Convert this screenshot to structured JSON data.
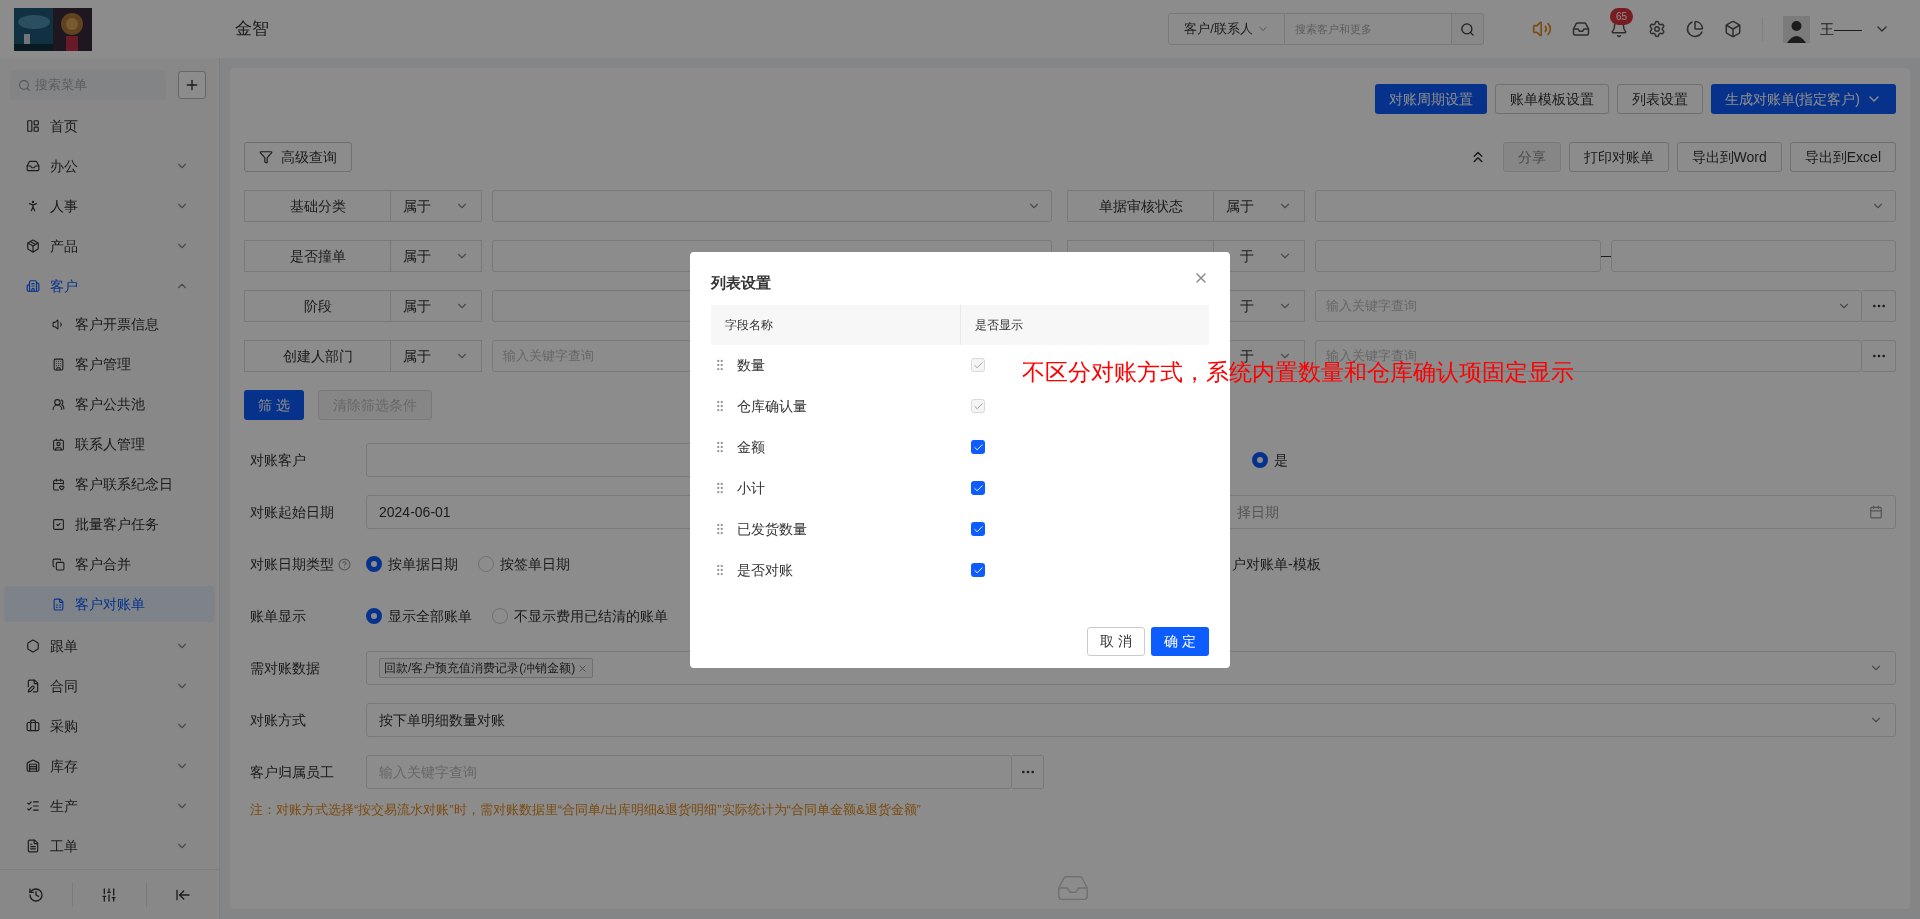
{
  "header": {
    "title": "金智",
    "search_scope": "客户/联系人",
    "search_placeholder": "搜索客户和更多",
    "notification_count": "65",
    "user_name": "王——"
  },
  "sidebar": {
    "search_placeholder": "搜索菜单",
    "items": [
      {
        "label": "首页"
      },
      {
        "label": "办公",
        "expanded": false
      },
      {
        "label": "人事",
        "expanded": false
      },
      {
        "label": "产品",
        "expanded": false
      },
      {
        "label": "客户",
        "expanded": true,
        "children": [
          {
            "label": "客户开票信息",
            "selected": false
          },
          {
            "label": "客户管理",
            "selected": false
          },
          {
            "label": "客户公共池",
            "selected": false
          },
          {
            "label": "联系人管理",
            "selected": false
          },
          {
            "label": "客户联系纪念日",
            "selected": false
          },
          {
            "label": "批量客户任务",
            "selected": false
          },
          {
            "label": "客户合并",
            "selected": false
          },
          {
            "label": "客户对账单",
            "selected": true
          }
        ]
      },
      {
        "label": "跟单",
        "expanded": false
      },
      {
        "label": "合同",
        "expanded": false
      },
      {
        "label": "采购",
        "expanded": false
      },
      {
        "label": "库存",
        "expanded": false
      },
      {
        "label": "生产",
        "expanded": false
      },
      {
        "label": "工单",
        "expanded": false
      }
    ]
  },
  "toolbar": [
    {
      "label": "对账周期设置",
      "kind": "primary"
    },
    {
      "label": "账单模板设置",
      "kind": "default"
    },
    {
      "label": "列表设置",
      "kind": "default"
    },
    {
      "label": "生成对账单(指定客户)",
      "kind": "menu"
    }
  ],
  "advanced_query": "高级查询",
  "actions": [
    {
      "label": "分享",
      "disabled": true
    },
    {
      "label": "打印对账单",
      "disabled": false
    },
    {
      "label": "导出到Word",
      "disabled": false
    },
    {
      "label": "导出到Excel",
      "disabled": false
    }
  ],
  "filters_left": [
    {
      "label": "基础分类",
      "operator": "属于",
      "kind": "select"
    },
    {
      "label": "是否撞单",
      "operator": "属于",
      "kind": "select"
    },
    {
      "label": "阶段",
      "operator": "属于",
      "kind": "select"
    },
    {
      "label": "创建人部门",
      "operator": "属于",
      "kind": "text",
      "placeholder": "输入关键字查询"
    }
  ],
  "filters_right": [
    {
      "label": "单据审核状态",
      "operator": "属于",
      "kind": "select"
    },
    {
      "operator": "于",
      "kind": "range"
    },
    {
      "operator": "于",
      "kind": "select_lookup",
      "placeholder": "输入关键字查询"
    },
    {
      "operator": "于",
      "kind": "text_lookup",
      "placeholder": "输入关键字查询"
    }
  ],
  "filter_buttons": [
    {
      "label": "筛 选",
      "disabled": false
    },
    {
      "label": "清除筛选条件",
      "disabled": true
    }
  ],
  "form": [
    {
      "label": "对账客户",
      "kind": "input",
      "aside": {
        "kind": "radio",
        "options": [
          {
            "label": "是",
            "selected": true
          }
        ]
      }
    },
    {
      "label": "对账起始日期",
      "kind": "input",
      "value": "2024-06-01",
      "aside": {
        "kind": "date",
        "placeholder": "择日期"
      }
    },
    {
      "label": "对账日期类型",
      "help": true,
      "kind": "radio",
      "options": [
        {
          "label": "按单据日期",
          "selected": true
        },
        {
          "label": "按签单日期",
          "selected": false
        }
      ],
      "aside": {
        "kind": "text",
        "text": "户对账单-模板"
      }
    },
    {
      "label": "账单显示",
      "kind": "radio",
      "options": [
        {
          "label": "显示全部账单",
          "selected": true
        },
        {
          "label": "不显示费用已结清的账单",
          "selected": false
        }
      ]
    },
    {
      "label": "需对账数据",
      "kind": "tags",
      "tags": [
        "回款/客户预充值消费记录(冲销金额)"
      ]
    },
    {
      "label": "对账方式",
      "kind": "select",
      "value": "按下单明细数量对账"
    },
    {
      "label": "客户归属员工",
      "kind": "lookup",
      "placeholder": "输入关键字查询"
    }
  ],
  "note": "注：对账方式选择“按交易流水对账”时，需对账数据里“合同单/出库明细&退货明细”实际统计为“合同单金额&退货金额”",
  "dialog": {
    "title": "列表设置",
    "columns": [
      "字段名称",
      "是否显示"
    ],
    "rows": [
      {
        "name": "数量",
        "checked": true,
        "disabled": true
      },
      {
        "name": "仓库确认量",
        "checked": true,
        "disabled": true
      },
      {
        "name": "金额",
        "checked": true,
        "disabled": false
      },
      {
        "name": "小计",
        "checked": true,
        "disabled": false
      },
      {
        "name": "已发货数量",
        "checked": true,
        "disabled": false
      },
      {
        "name": "是否对账",
        "checked": true,
        "disabled": false
      }
    ],
    "buttons": [
      {
        "label": "取 消",
        "kind": "default"
      },
      {
        "label": "确 定",
        "kind": "primary"
      }
    ]
  },
  "annotation": "不区分对账方式，系统内置数量和仓库确认项固定显示"
}
